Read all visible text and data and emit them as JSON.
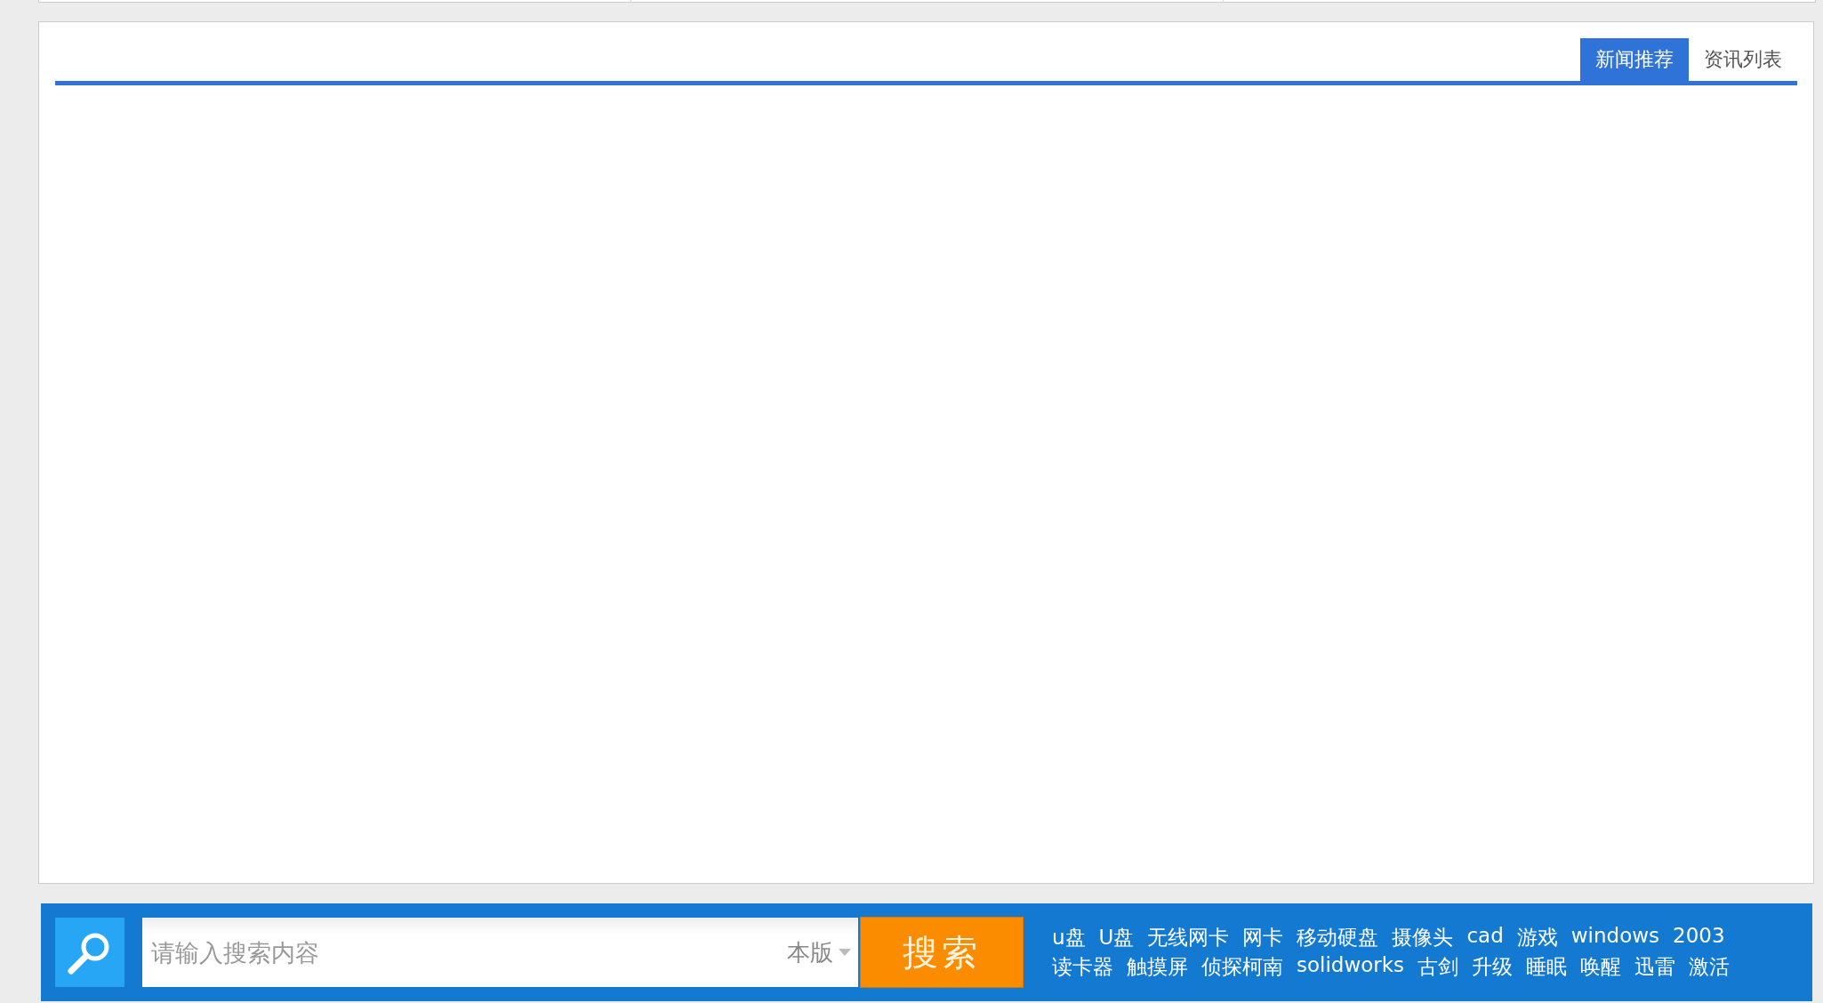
{
  "news_panel": {
    "tabs": [
      {
        "label": "新闻推荐",
        "selected": true
      },
      {
        "label": "资讯列表",
        "selected": false
      }
    ]
  },
  "search_bar": {
    "placeholder": "请输入搜索内容",
    "scope": "本版",
    "button": "搜索",
    "hot_keywords": [
      [
        "u盘",
        "U盘",
        "无线网卡",
        "网卡",
        "移动硬盘",
        "摄像头",
        "cad",
        "游戏",
        "windows",
        "2003"
      ],
      [
        "读卡器",
        "触摸屏",
        "侦探柯南",
        "solidworks",
        "古剑",
        "升级",
        "睡眠",
        "唤醒",
        "迅雷",
        "激活"
      ]
    ]
  }
}
